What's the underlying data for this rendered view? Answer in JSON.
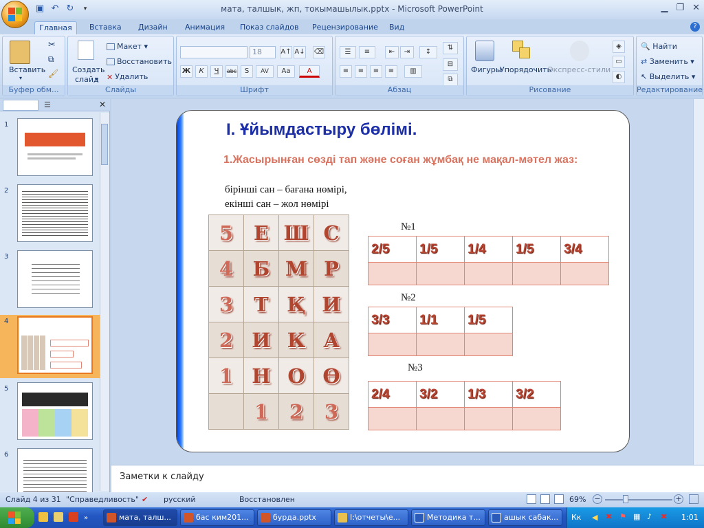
{
  "window": {
    "title": "мата, талшык, жп, токымашылык.pptx - Microsoft PowerPoint"
  },
  "ribbon": {
    "tabs": [
      "Главная",
      "Вставка",
      "Дизайн",
      "Анимация",
      "Показ слайдов",
      "Рецензирование",
      "Вид"
    ],
    "active_tab": "Главная",
    "clipboard": {
      "paste": "Вставить",
      "label": "Буфер обм..."
    },
    "slides": {
      "new_slide_line1": "Создать",
      "new_slide_line2": "слайд",
      "layout": "Макет",
      "reset": "Восстановить",
      "delete": "Удалить",
      "label": "Слайды"
    },
    "font": {
      "size": "18",
      "label": "Шрифт",
      "bold": "Ж",
      "italic": "К",
      "underline": "Ч",
      "strike": "abc",
      "shadow": "S",
      "spacing": "AV",
      "case": "Aa",
      "color": "A"
    },
    "paragraph": {
      "label": "Абзац"
    },
    "drawing": {
      "shapes": "Фигуры",
      "arrange": "Упорядочить",
      "styles": "Экспресс-стили",
      "label": "Рисование"
    },
    "editing": {
      "find": "Найти",
      "replace": "Заменить",
      "select": "Выделить",
      "label": "Редактирование"
    }
  },
  "thumbnails": [
    {
      "num": "1"
    },
    {
      "num": "2"
    },
    {
      "num": "3"
    },
    {
      "num": "4"
    },
    {
      "num": "5"
    },
    {
      "num": "6"
    }
  ],
  "slide": {
    "title": "I. Ұйымдастыру бөлімі.",
    "subtitle": "1.Жасырынған сөзді тап және соған жұмбақ не мақал-мәтел жаз:",
    "line1": "бірінші сан – бағана нөмірі,",
    "line2": "екінші сан – жол нөмірі",
    "grid": [
      [
        "5",
        "Е",
        "Ш",
        "С"
      ],
      [
        "4",
        "Б",
        "М",
        "Р"
      ],
      [
        "3",
        "Т",
        "Қ",
        "И"
      ],
      [
        "2",
        "И",
        "К",
        "А"
      ],
      [
        "1",
        "Н",
        "О",
        "Ө"
      ],
      [
        "",
        "1",
        "2",
        "3"
      ]
    ],
    "codes": [
      {
        "label": "№1",
        "cells": [
          "2/5",
          "1/5",
          "1/4",
          "1/5",
          "3/4"
        ]
      },
      {
        "label": "№2",
        "cells": [
          "3/3",
          "1/1",
          "1/5"
        ]
      },
      {
        "label": "№3",
        "cells": [
          "2/4",
          "3/2",
          "1/3",
          "3/2"
        ]
      }
    ]
  },
  "notes": {
    "placeholder": "Заметки к слайду"
  },
  "status": {
    "slide": "Слайд 4 из 31",
    "theme": "\"Справедливость\"",
    "language": "русский",
    "state": "Восстановлен",
    "zoom": "69%"
  },
  "taskbar": {
    "items": [
      "мата, талш...",
      "бас ким201...",
      "бурда.pptx",
      "I:\\отчеты\\е...",
      "Методика т...",
      "ашык сабак..."
    ],
    "lang": "Кк",
    "time": "1:01"
  }
}
